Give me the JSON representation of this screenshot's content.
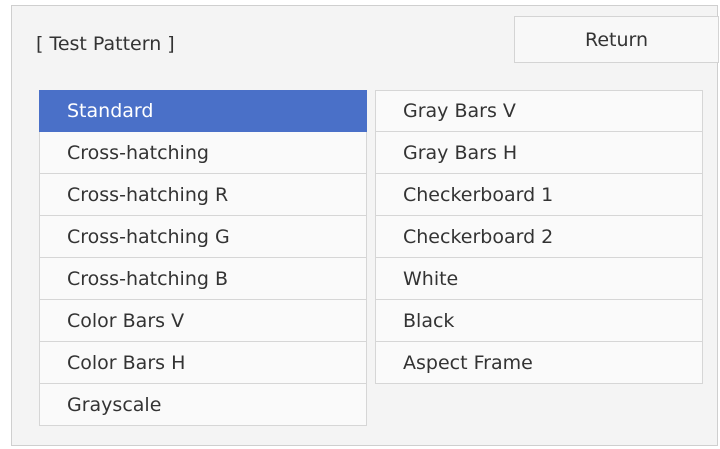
{
  "header": {
    "title": "[ Test Pattern ]",
    "return_label": "Return"
  },
  "patterns_left": [
    {
      "label": "Standard",
      "selected": true
    },
    {
      "label": "Cross-hatching",
      "selected": false
    },
    {
      "label": "Cross-hatching R",
      "selected": false
    },
    {
      "label": "Cross-hatching G",
      "selected": false
    },
    {
      "label": "Cross-hatching B",
      "selected": false
    },
    {
      "label": "Color Bars V",
      "selected": false
    },
    {
      "label": "Color Bars H",
      "selected": false
    },
    {
      "label": "Grayscale",
      "selected": false
    }
  ],
  "patterns_right": [
    {
      "label": "Gray Bars V",
      "selected": false
    },
    {
      "label": "Gray Bars H",
      "selected": false
    },
    {
      "label": "Checkerboard 1",
      "selected": false
    },
    {
      "label": "Checkerboard 2",
      "selected": false
    },
    {
      "label": "White",
      "selected": false
    },
    {
      "label": "Black",
      "selected": false
    },
    {
      "label": "Aspect Frame",
      "selected": false
    }
  ],
  "colors": {
    "selection": "#4a70c8",
    "panel_background": "#f4f4f4",
    "item_background": "#fafafa",
    "text": "#333333"
  }
}
